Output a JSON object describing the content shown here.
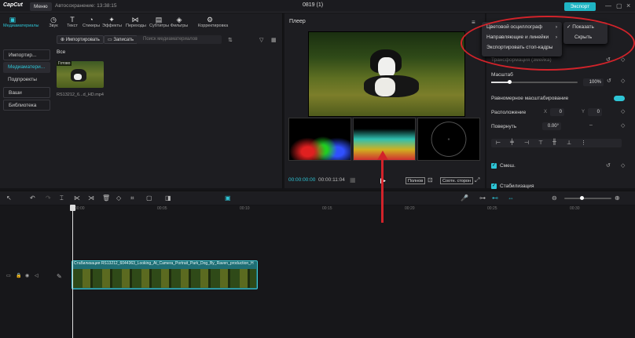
{
  "titlebar": {
    "logo": "CapCut",
    "menu_label": "Меню",
    "autosave": "Автосохранение: 13:38:15",
    "project_name": "0819 (1)",
    "export_label": "Экспорт"
  },
  "toolbar": {
    "tools": [
      {
        "label": "Медиаматериалы",
        "icon": "media-icon"
      },
      {
        "label": "Звук",
        "icon": "sound-icon"
      },
      {
        "label": "Текст",
        "icon": "text-icon"
      },
      {
        "label": "Стикеры",
        "icon": "sticker-icon"
      },
      {
        "label": "Эффекты",
        "icon": "effects-icon"
      },
      {
        "label": "Переходы",
        "icon": "transitions-icon"
      },
      {
        "label": "Субтитры",
        "icon": "subtitles-icon"
      },
      {
        "label": "Фильтры",
        "icon": "filters-icon"
      },
      {
        "label": "Корректировка",
        "icon": "adjust-icon"
      }
    ]
  },
  "sidebar": {
    "items": [
      {
        "label": "Импортир..."
      },
      {
        "label": "Медиаматери..."
      },
      {
        "label": "Подпроекты"
      },
      {
        "label": "Ваши"
      },
      {
        "label": "Библиотека"
      }
    ]
  },
  "media": {
    "import_label": "Импортировать",
    "record_label": "Записать",
    "search_placeholder": "Поиск медиаматериалов",
    "all_label": "Все",
    "thumb_tag": "Готово",
    "thumb_name": "RS13212_6...d_HD.mp4"
  },
  "player": {
    "title": "Плеер",
    "current_time": "00:00:00:00",
    "total_time": "00:00:11:04",
    "full_label": "Полнов",
    "ratio_label": "Соотн. сторон"
  },
  "dropdown": {
    "items": [
      {
        "label": "Цветовой осциллограф"
      },
      {
        "label": "Направляющие и линейки"
      },
      {
        "label": "Экспортировать стоп-кадры"
      }
    ],
    "sub_items": [
      {
        "label": "Показать"
      },
      {
        "label": "Скрыть"
      }
    ]
  },
  "props": {
    "transform_label": "Трансформация (змейка)",
    "scale_label": "Масштаб",
    "scale_value": "100%",
    "scale_fraction": 1.0,
    "uniform_scale_label": "Равномерное масштабирование",
    "position_label": "Расположение",
    "pos_x_label": "X",
    "pos_x_value": "0",
    "pos_y_label": "Y",
    "pos_y_value": "0",
    "rotate_label": "Повернуть",
    "rotate_value": "0.00°",
    "blend_label": "Смеш.",
    "stabilization_label": "Стабилизация"
  },
  "timeline": {
    "ruler": [
      "00:00",
      "00:05",
      "00:10",
      "00:15",
      "00:20",
      "00:25",
      "00:30"
    ],
    "clip_label": "Стабилизация  RS13212_6044363_Looking_At_Camera_Portrait_Park_Dog_By_Raven_production_H"
  },
  "colors": {
    "accent": "#2ec5d6",
    "annotation_red": "#d2232a"
  }
}
